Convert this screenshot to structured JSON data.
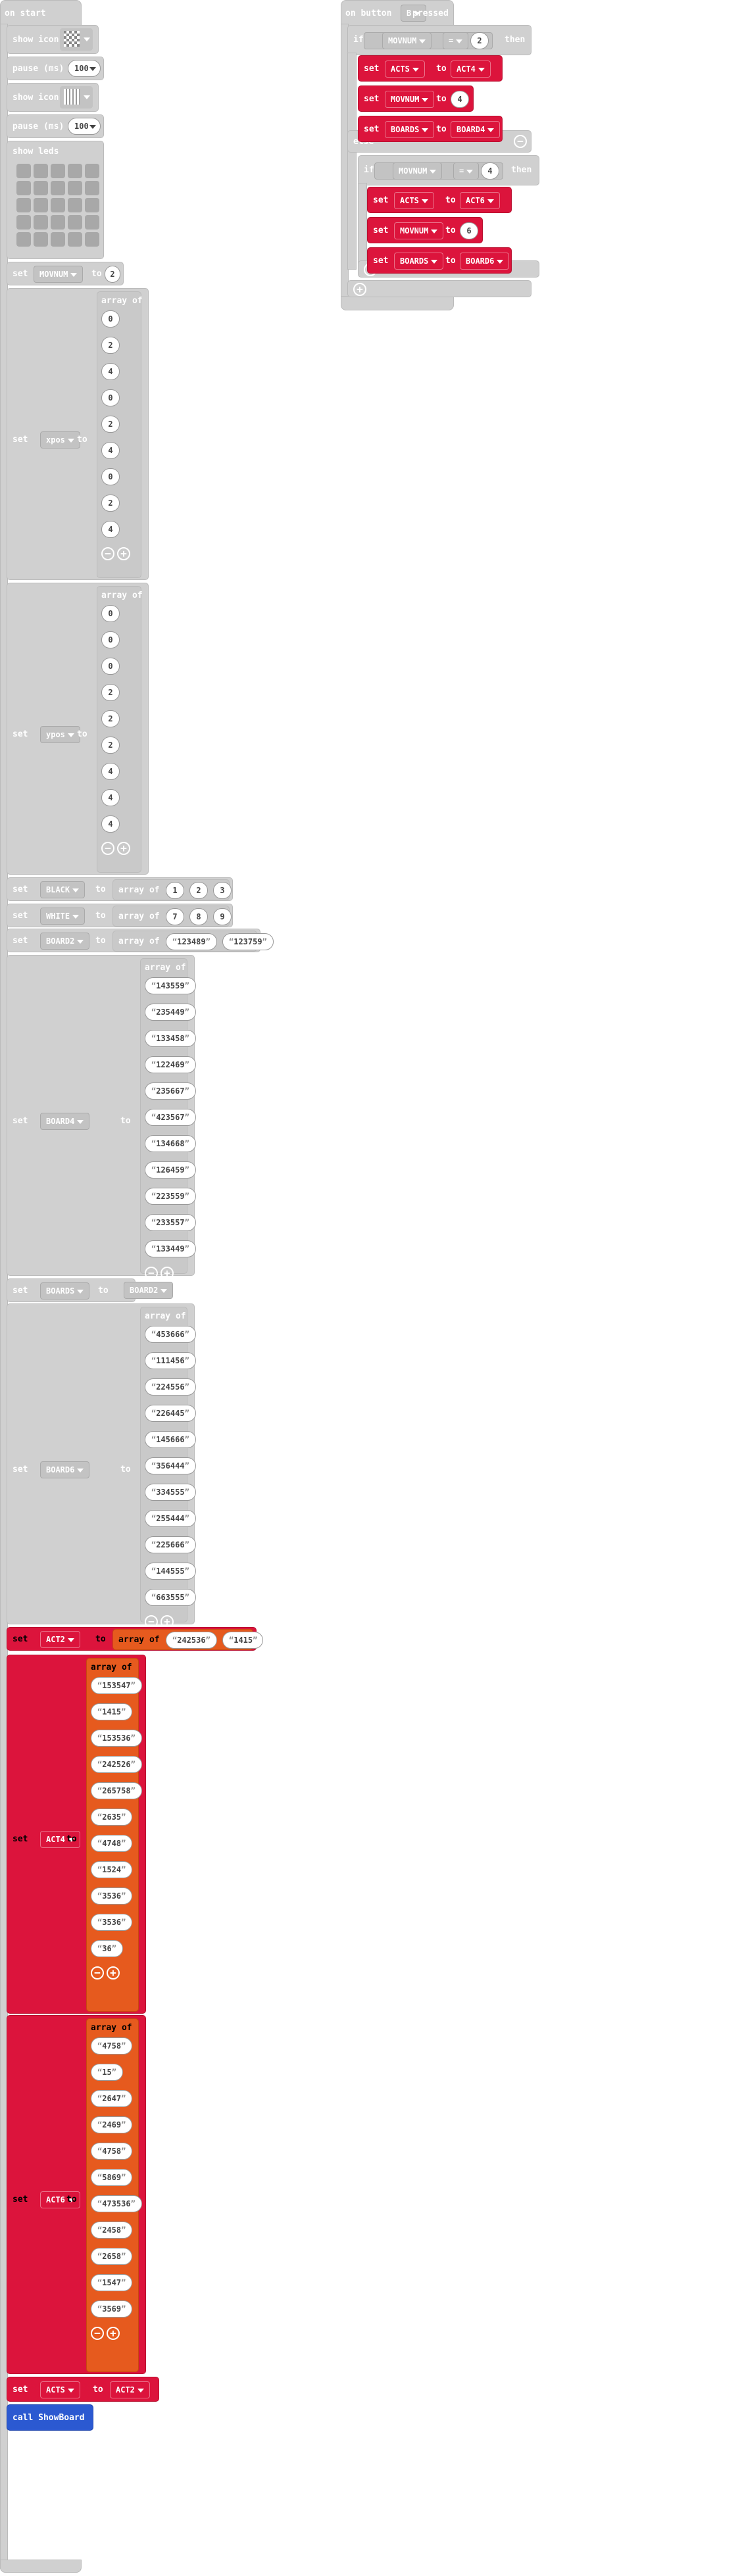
{
  "on_start": {
    "title": "on start",
    "show_icon_label": "show icon",
    "pause_label": "pause (ms)",
    "pause_value": "100",
    "show_leds_label": "show leds",
    "set_label": "set",
    "to_label": "to",
    "array_of_label": "array of",
    "movnum": {
      "var": "MOVNUM",
      "value": "2"
    },
    "xpos": {
      "var": "xpos",
      "values": [
        "0",
        "2",
        "4",
        "0",
        "2",
        "4",
        "0",
        "2",
        "4"
      ]
    },
    "ypos": {
      "var": "ypos",
      "values": [
        "0",
        "0",
        "0",
        "2",
        "2",
        "2",
        "4",
        "4",
        "4"
      ]
    },
    "black": {
      "var": "BLACK",
      "values": [
        "1",
        "2",
        "3"
      ]
    },
    "white": {
      "var": "WHITE",
      "values": [
        "7",
        "8",
        "9"
      ]
    },
    "board2": {
      "var": "BOARD2",
      "values": [
        "123489",
        "123759"
      ]
    },
    "board4": {
      "var": "BOARD4",
      "values": [
        "143559",
        "235449",
        "133458",
        "122469",
        "235667",
        "423567",
        "134668",
        "126459",
        "223559",
        "233557",
        "133449"
      ]
    },
    "boards": {
      "var": "BOARDS",
      "value_var": "BOARD2"
    },
    "board6": {
      "var": "BOARD6",
      "values": [
        "453666",
        "111456",
        "224556",
        "226445",
        "145666",
        "356444",
        "334555",
        "255444",
        "225666",
        "144555",
        "663555"
      ]
    },
    "act2": {
      "var": "ACT2",
      "values": [
        "242536",
        "1415"
      ]
    },
    "act4": {
      "var": "ACT4",
      "values": [
        "153547",
        "1415",
        "153536",
        "242526",
        "265758",
        "2635",
        "4748",
        "1524",
        "3536",
        "3536",
        "36"
      ]
    },
    "act6": {
      "var": "ACT6",
      "values": [
        "4758",
        "15",
        "2647",
        "2469",
        "4758",
        "5869",
        "473536",
        "2458",
        "2658",
        "1547",
        "3569"
      ]
    },
    "acts": {
      "var": "ACTS",
      "value_var": "ACT2"
    },
    "call_label": "call ShowBoard"
  },
  "on_button": {
    "title_prefix": "on button",
    "button": "B",
    "title_suffix": "pressed",
    "if_label": "if",
    "then_label": "then",
    "else_label": "else",
    "op": "=",
    "cond1": {
      "var": "MOVNUM",
      "value": "2"
    },
    "then1": [
      {
        "var": "ACTS",
        "value_var": "ACT4"
      },
      {
        "var": "MOVNUM",
        "value": "4"
      },
      {
        "var": "BOARDS",
        "value_var": "BOARD4"
      }
    ],
    "cond2": {
      "var": "MOVNUM",
      "value": "4"
    },
    "then2": [
      {
        "var": "ACTS",
        "value_var": "ACT6"
      },
      {
        "var": "MOVNUM",
        "value": "6"
      },
      {
        "var": "BOARDS",
        "value_var": "BOARD6"
      }
    ]
  },
  "colors": {
    "gray": "#d0d0d0",
    "red": "#dc143c",
    "orange": "#e65a1e",
    "blue": "#2b59d1"
  }
}
